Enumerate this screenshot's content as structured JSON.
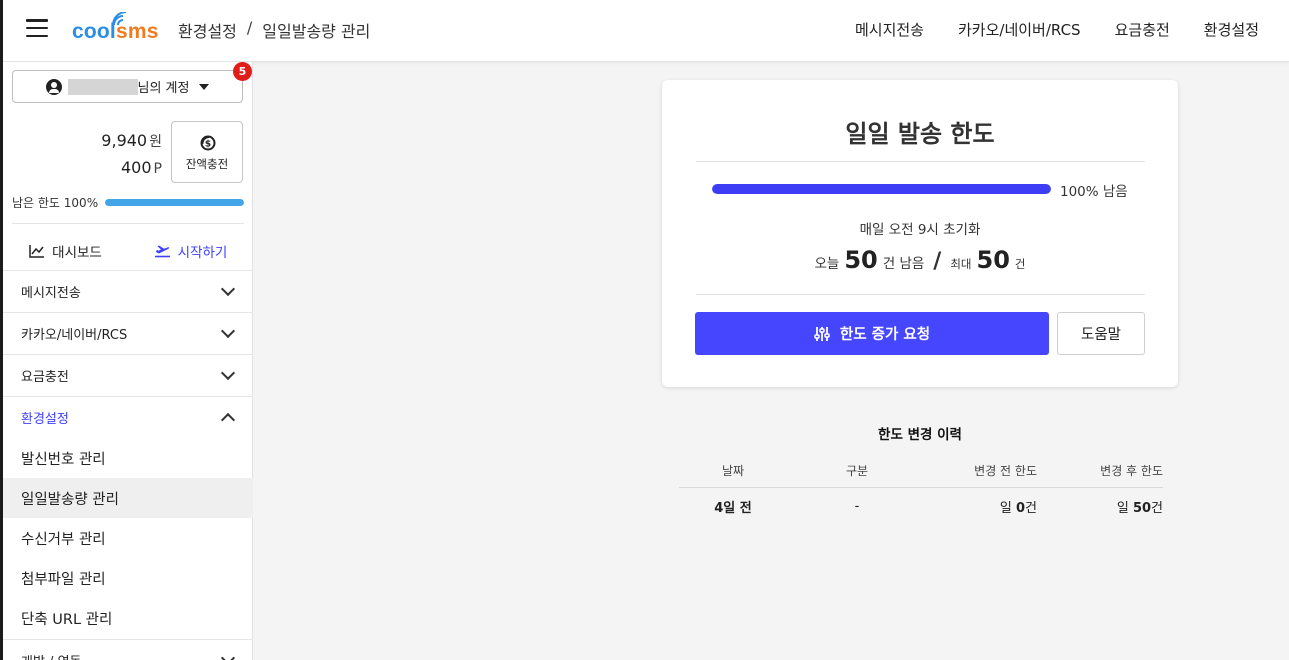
{
  "header": {
    "logo_part1": "cool",
    "logo_part2": "sms",
    "breadcrumb": [
      "환경설정",
      "/",
      "일일발송량 관리"
    ],
    "nav": [
      "메시지전송",
      "카카오/네이버/RCS",
      "요금충전",
      "환경설정"
    ],
    "logo_colors": {
      "cool": "#2a8ee8",
      "sms": "#f07c22"
    }
  },
  "sidebar": {
    "account_suffix": "님의 계정",
    "notice_count": "5",
    "balance_won": "9,940",
    "won_unit": "원",
    "balance_point": "400",
    "point_unit": "P",
    "charge_label": "잔액충전",
    "limit_label": "남은 한도 100%",
    "limit_fraction": 1.0,
    "dashboard_label": "대시보드",
    "start_label": "시작하기",
    "sections": [
      "메시지전송",
      "카카오/네이버/RCS",
      "요금충전",
      "환경설정",
      "개발 / 연동"
    ],
    "settings_items": [
      "발신번호 관리",
      "일일발송량 관리",
      "수신거부 관리",
      "첨부파일 관리",
      "단축 URL 관리"
    ],
    "accent_color": "#4040ff"
  },
  "main": {
    "title": "일일 발송 한도",
    "progress_fraction": 1.0,
    "progress_label": "100% 남음",
    "reset_text": "매일 오전 9시 초기화",
    "today_prefix": "오늘",
    "today_remaining": "50",
    "today_suffix": "건 남음",
    "slash": "/",
    "max_prefix": "최대",
    "max_value": "50",
    "max_suffix": "건",
    "request_button": "한도 증가 요청",
    "help_button": "도움말",
    "button_color": "#4646ff"
  },
  "history": {
    "title": "한도 변경 이력",
    "columns": [
      "날짜",
      "구분",
      "변경 전 한도",
      "변경 후 한도"
    ],
    "rows": [
      {
        "date": "4일 전",
        "type": "-",
        "before_prefix": "일",
        "before_value": "0",
        "before_unit": "건",
        "after_prefix": "일",
        "after_value": "50",
        "after_unit": "건"
      }
    ]
  }
}
